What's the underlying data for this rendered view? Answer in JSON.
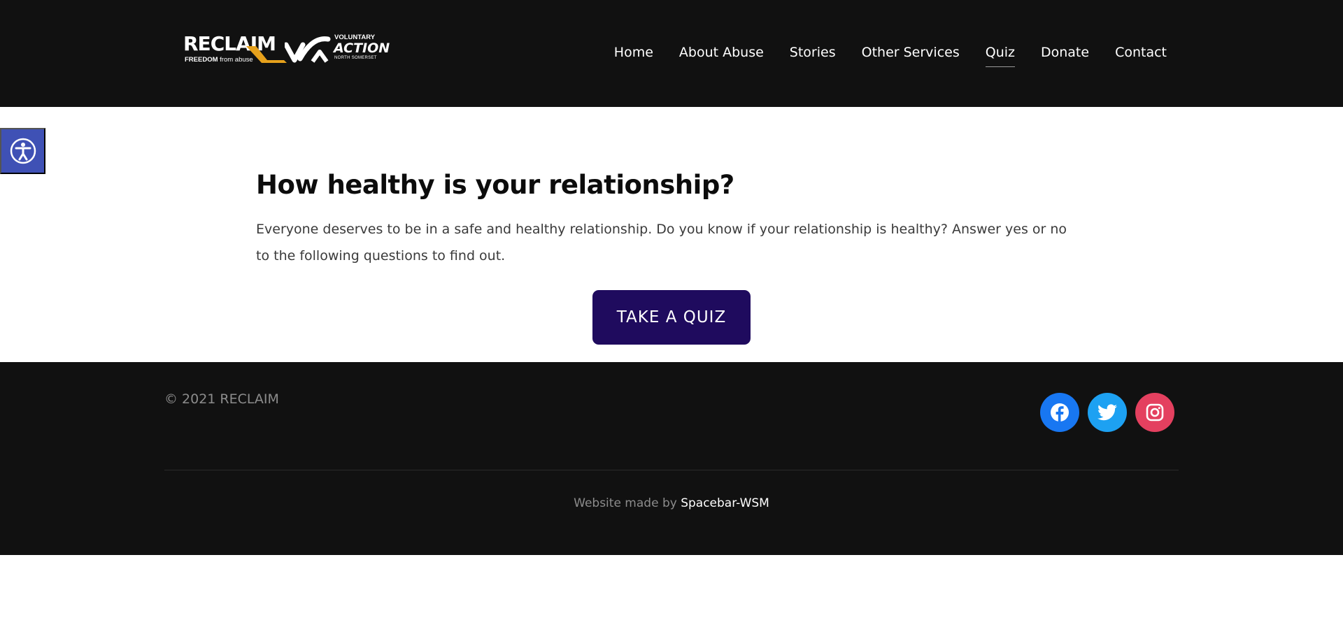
{
  "header": {
    "logo": {
      "reclaim": "RECLAIM",
      "tagline_bold": "FREEDOM",
      "tagline_light": "from abuse",
      "va_line1": "VOLUNTARY",
      "va_line2": "ACTION",
      "va_line3": "NORTH SOMERSET"
    },
    "nav": [
      {
        "label": "Home"
      },
      {
        "label": "About Abuse"
      },
      {
        "label": "Stories"
      },
      {
        "label": "Other Services"
      },
      {
        "label": "Quiz",
        "active": true
      },
      {
        "label": "Donate"
      },
      {
        "label": "Contact"
      }
    ]
  },
  "main": {
    "heading": "How healthy is your relationship?",
    "intro": "Everyone deserves to be in a safe and healthy relationship. Do you know if your relationship is healthy? Answer yes or no to the following questions to find out.",
    "cta_label": "TAKE A QUIZ"
  },
  "footer": {
    "copyright": "© 2021 RECLAIM",
    "social": [
      {
        "icon": "facebook-icon",
        "color": "#1877f2"
      },
      {
        "icon": "twitter-icon",
        "color": "#1da1f2"
      },
      {
        "icon": "instagram-icon",
        "color": "#e4405f"
      }
    ],
    "credit_prefix": "Website made by",
    "credit_link": "Spacebar-WSM"
  },
  "accessibility": {
    "icon": "accessibility-icon",
    "color": "#3f51b5"
  },
  "colors": {
    "header_bg": "#111111",
    "cta_bg": "#1f0b5e",
    "logo_accent": "#e6a11c"
  }
}
